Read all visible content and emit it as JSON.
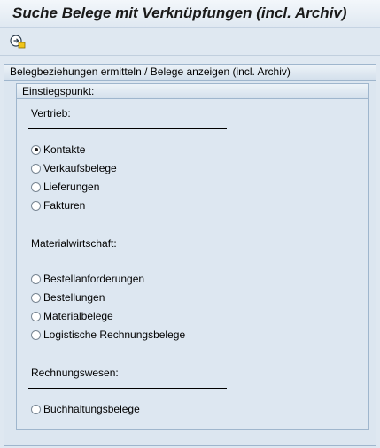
{
  "window": {
    "title": "Suche Belege mit Verknüpfungen (incl. Archiv)"
  },
  "toolbar": {
    "execute_icon": "execute-icon"
  },
  "panel": {
    "title": "Belegbeziehungen ermitteln / Belege anzeigen (incl. Archiv)",
    "group_title": "Einstiegspunkt:",
    "sections": [
      {
        "label": "Vertrieb:",
        "options": [
          "Kontakte",
          "Verkaufsbelege",
          "Lieferungen",
          "Fakturen"
        ]
      },
      {
        "label": "Materialwirtschaft:",
        "options": [
          "Bestellanforderungen",
          "Bestellungen",
          "Materialbelege",
          "Logistische Rechnungsbelege"
        ]
      },
      {
        "label": "Rechnungswesen:",
        "options": [
          "Buchhaltungsbelege"
        ]
      }
    ],
    "selected": "Kontakte"
  }
}
